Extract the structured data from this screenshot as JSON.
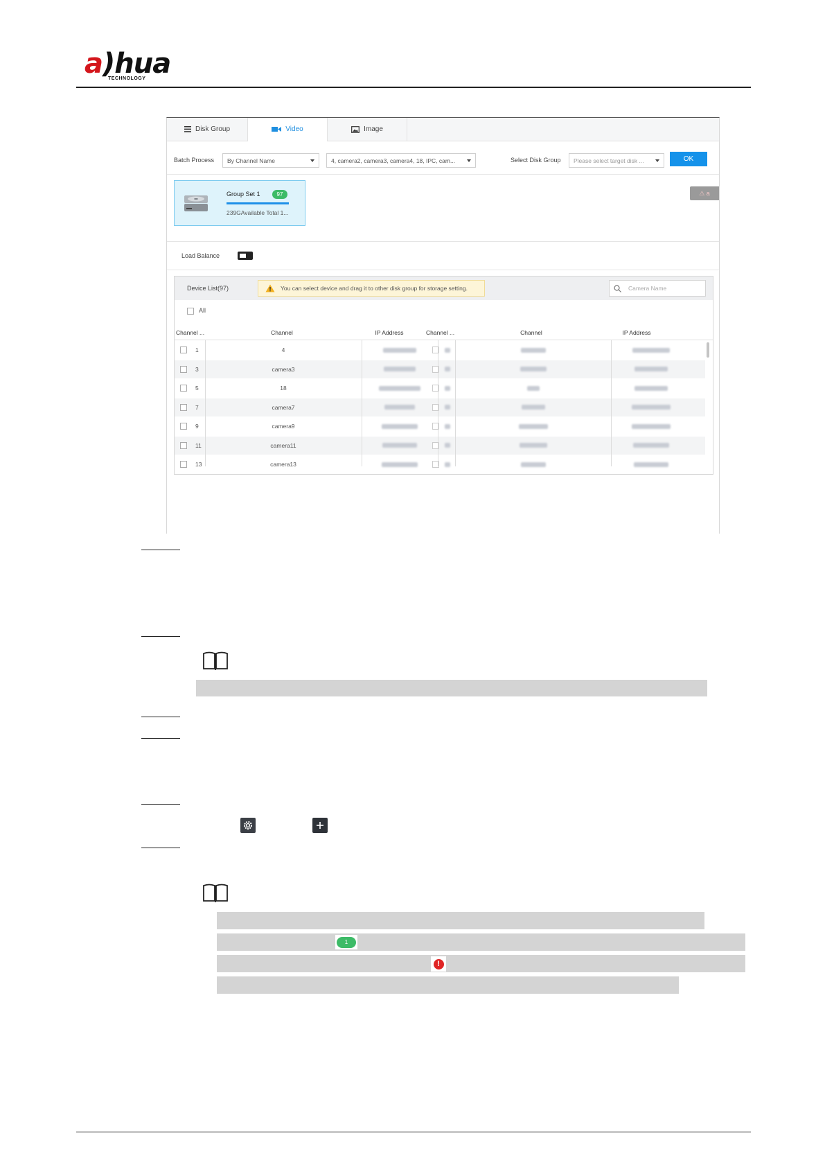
{
  "header": {
    "logo_text_a": "a",
    "logo_text_rest": "hua",
    "logo_sub": "TECHNOLOGY"
  },
  "screenshot": {
    "tabs": [
      {
        "label": "Disk Group",
        "icon": "list-icon",
        "active": false
      },
      {
        "label": "Video",
        "icon": "video-camera-icon",
        "active": true
      },
      {
        "label": "Image",
        "icon": "image-icon",
        "active": false
      }
    ],
    "toolbar": {
      "batch_label": "Batch Process",
      "batch_value": "By Channel Name",
      "channels_value": "4, camera2, camera3, camera4, 18, IPC, cam...",
      "disk_group_label": "Select Disk Group",
      "disk_group_placeholder": "Please select target disk ...",
      "ok_label": "OK"
    },
    "group_card": {
      "name": "Group Set 1",
      "count": "97",
      "capacity": "239GAvailable Total 1..."
    },
    "warning_chip": "⚠ a",
    "load_balance_label": "Load Balance",
    "device_list": {
      "title": "Device List(97)",
      "tip": "You can select device and drag it to other disk group for storage setting.",
      "search_placeholder": "Camera Name",
      "all_label": "All",
      "columns": [
        "Channel ...",
        "Channel",
        "IP Address",
        "Channel ...",
        "Channel",
        "IP Address"
      ],
      "rows": [
        {
          "no": "1",
          "channel": "4"
        },
        {
          "no": "3",
          "channel": "camera3"
        },
        {
          "no": "5",
          "channel": "18"
        },
        {
          "no": "7",
          "channel": "camera7"
        },
        {
          "no": "9",
          "channel": "camera9"
        },
        {
          "no": "11",
          "channel": "camera11"
        },
        {
          "no": "13",
          "channel": "camera13"
        }
      ]
    }
  },
  "inline_badge": "1",
  "inline_alert": "!",
  "icons": {
    "gear": "gear-icon",
    "plus": "plus-icon",
    "note": "book-note-icon"
  },
  "colors": {
    "accent": "#1592ea",
    "badge": "#3dbb67",
    "alert": "#e02424",
    "brand_red": "#d4161c"
  }
}
